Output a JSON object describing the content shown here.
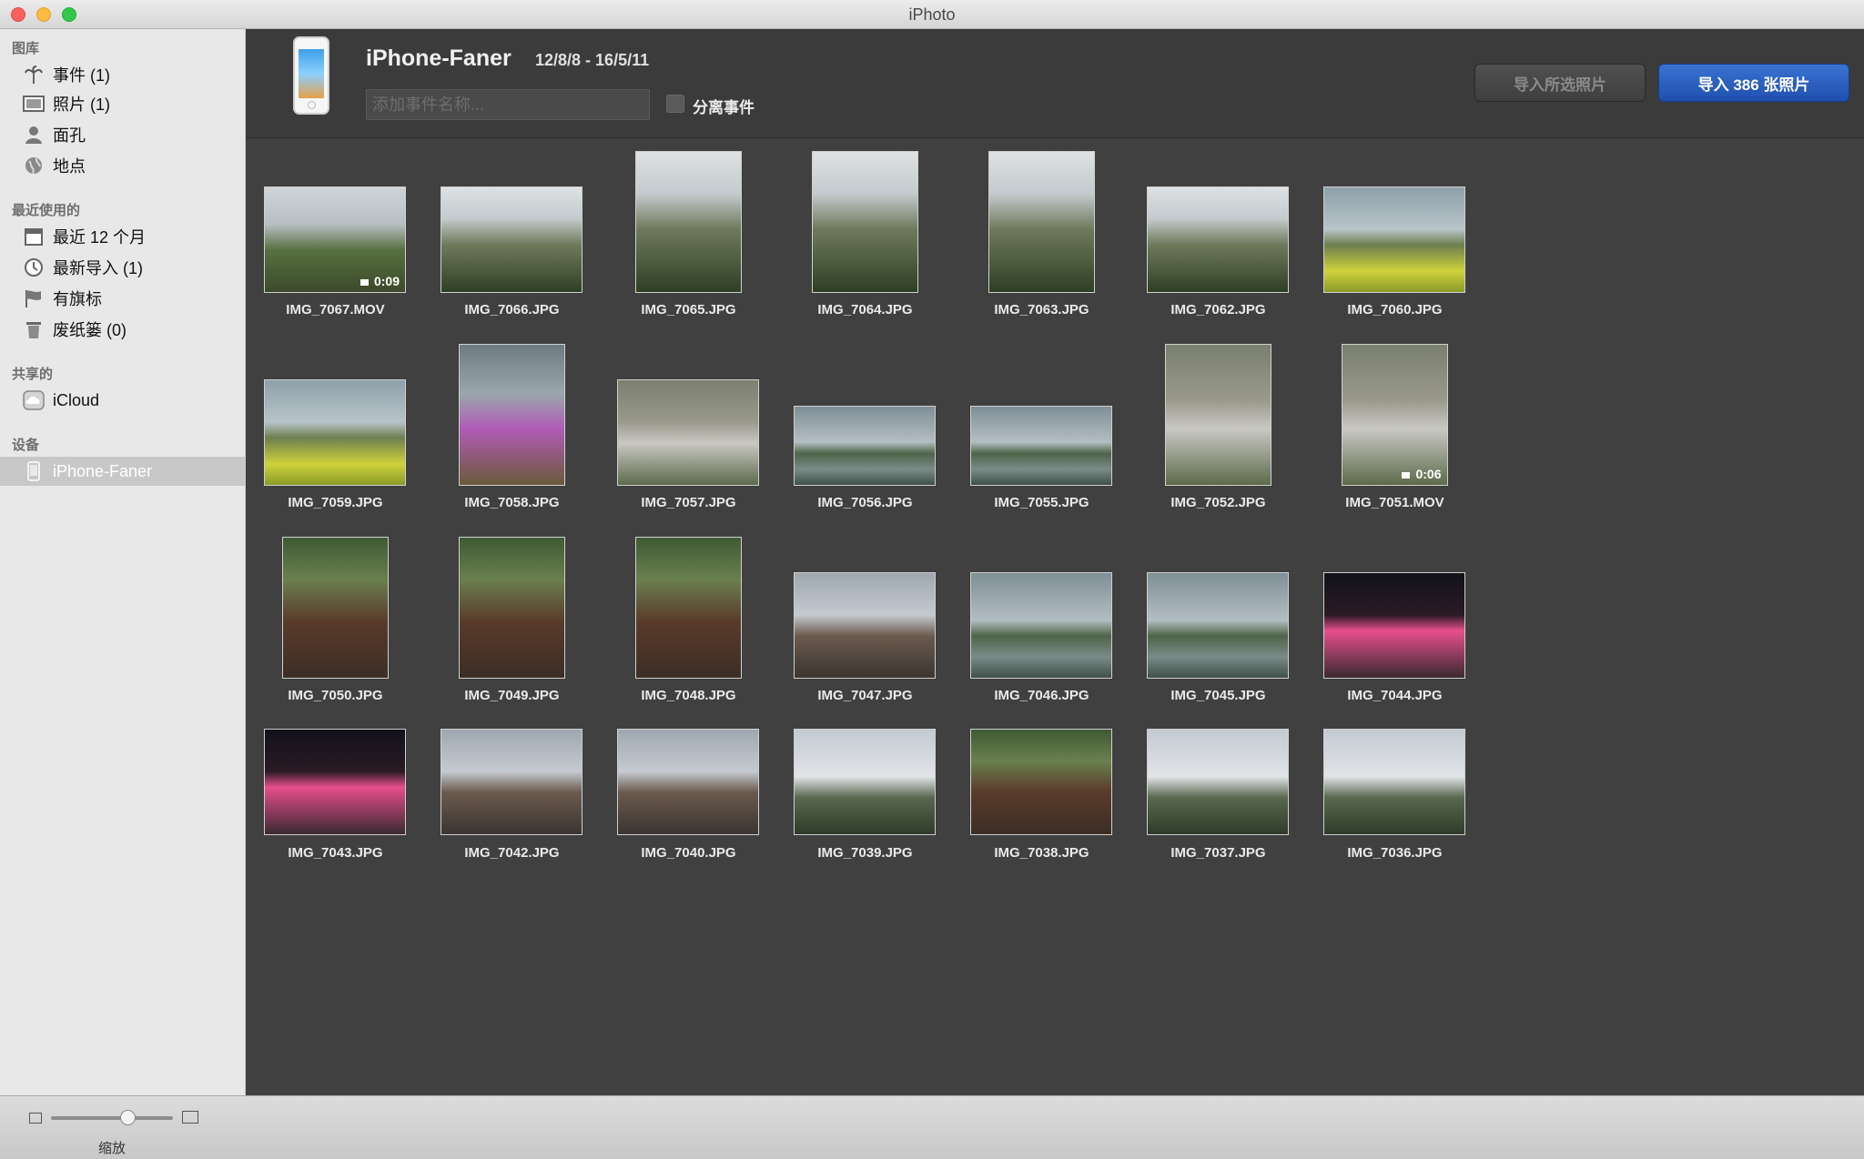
{
  "window": {
    "title": "iPhoto"
  },
  "sidebar": {
    "sections": [
      {
        "title": "图库",
        "items": [
          {
            "label": "事件 (1)",
            "icon": "palm-tree-icon"
          },
          {
            "label": "照片 (1)",
            "icon": "photo-icon"
          },
          {
            "label": "面孔",
            "icon": "person-icon"
          },
          {
            "label": "地点",
            "icon": "globe-icon"
          }
        ]
      },
      {
        "title": "最近使用的",
        "items": [
          {
            "label": "最近 12 个月",
            "icon": "calendar-icon"
          },
          {
            "label": "最新导入 (1)",
            "icon": "clock-icon"
          },
          {
            "label": "有旗标",
            "icon": "flag-icon"
          },
          {
            "label": "废纸篓 (0)",
            "icon": "trash-icon"
          }
        ]
      },
      {
        "title": "共享的",
        "items": [
          {
            "label": "iCloud",
            "icon": "cloud-icon"
          }
        ]
      },
      {
        "title": "设备",
        "items": [
          {
            "label": "iPhone-Faner",
            "icon": "iphone-icon",
            "selected": true
          }
        ]
      }
    ]
  },
  "header": {
    "device_name": "iPhone-Faner",
    "date_range": "12/8/8 - 16/5/11",
    "event_name_placeholder": "添加事件名称...",
    "split_events_label": "分离事件",
    "split_events_checked": false,
    "import_selected_label": "导入所选照片",
    "import_all_label": "导入 386 张照片"
  },
  "photos": [
    {
      "name": "IMG_7067.MOV",
      "duration": "0:09"
    },
    {
      "name": "IMG_7066.JPG"
    },
    {
      "name": "IMG_7065.JPG"
    },
    {
      "name": "IMG_7064.JPG"
    },
    {
      "name": "IMG_7063.JPG"
    },
    {
      "name": "IMG_7062.JPG"
    },
    {
      "name": "IMG_7060.JPG"
    },
    {
      "name": "IMG_7059.JPG"
    },
    {
      "name": "IMG_7058.JPG"
    },
    {
      "name": "IMG_7057.JPG"
    },
    {
      "name": "IMG_7056.JPG"
    },
    {
      "name": "IMG_7055.JPG"
    },
    {
      "name": "IMG_7052.JPG"
    },
    {
      "name": "IMG_7051.MOV",
      "duration": "0:06"
    },
    {
      "name": "IMG_7050.JPG"
    },
    {
      "name": "IMG_7049.JPG"
    },
    {
      "name": "IMG_7048.JPG"
    },
    {
      "name": "IMG_7047.JPG"
    },
    {
      "name": "IMG_7046.JPG"
    },
    {
      "name": "IMG_7045.JPG"
    },
    {
      "name": "IMG_7044.JPG"
    },
    {
      "name": "IMG_7043.JPG"
    },
    {
      "name": "IMG_7042.JPG"
    },
    {
      "name": "IMG_7040.JPG"
    },
    {
      "name": "IMG_7039.JPG"
    },
    {
      "name": "IMG_7038.JPG"
    },
    {
      "name": "IMG_7037.JPG"
    },
    {
      "name": "IMG_7036.JPG"
    }
  ],
  "footer": {
    "zoom_label": "缩放",
    "zoom_level": 0.6
  },
  "colors": {
    "accent": "#2a5fc4",
    "sidebar_selected": "#c8c8c8",
    "content_bg": "#404040"
  }
}
